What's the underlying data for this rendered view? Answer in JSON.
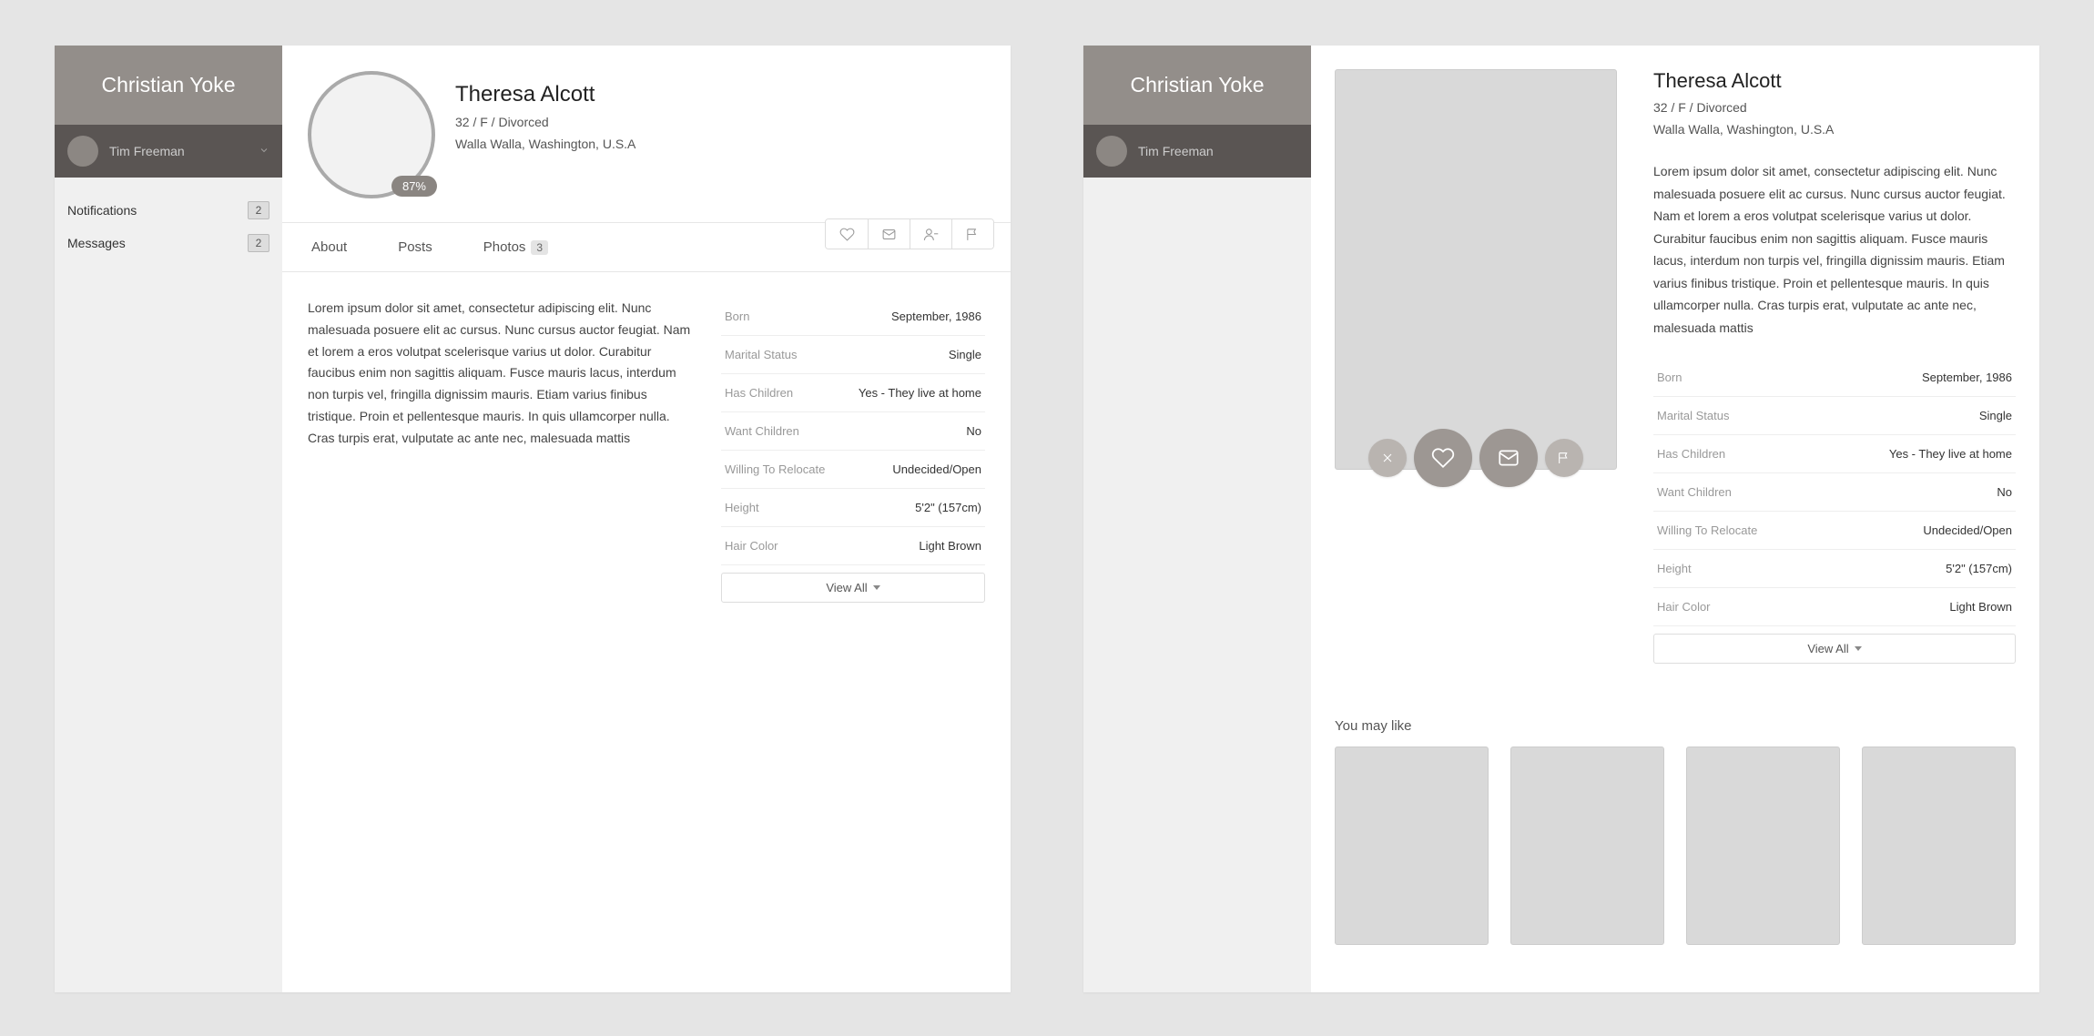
{
  "sidebar": {
    "brand": "Christian Yoke",
    "user_name": "Tim Freeman",
    "nav": [
      {
        "label": "Notifications",
        "count": "2"
      },
      {
        "label": "Messages",
        "count": "2"
      }
    ]
  },
  "profile": {
    "name": "Theresa Alcott",
    "meta": "32 / F / Divorced",
    "location": "Walla Walla, Washington, U.S.A",
    "match_percent": "87%",
    "bio": "Lorem ipsum dolor sit amet, consectetur adipiscing elit. Nunc malesuada posuere elit ac cursus. Nunc cursus auctor feugiat. Nam et lorem a eros volutpat scelerisque varius ut dolor. Curabitur faucibus enim non sagittis aliquam. Fusce mauris lacus, interdum non turpis vel, fringilla dignissim mauris. Etiam varius finibus tristique. Proin et pellentesque mauris. In quis ullamcorper nulla. Cras turpis erat, vulputate ac ante nec, malesuada mattis"
  },
  "tabs": {
    "about": "About",
    "posts": "Posts",
    "photos": "Photos",
    "photos_count": "3"
  },
  "details": [
    {
      "k": "Born",
      "v": "September, 1986"
    },
    {
      "k": "Marital Status",
      "v": "Single"
    },
    {
      "k": "Has Children",
      "v": "Yes - They live at home"
    },
    {
      "k": "Want Children",
      "v": "No"
    },
    {
      "k": "Willing To Relocate",
      "v": "Undecided/Open"
    },
    {
      "k": "Height",
      "v": "5'2\" (157cm)"
    },
    {
      "k": "Hair Color",
      "v": "Light Brown"
    }
  ],
  "view_all": "View All",
  "suggest_title": "You may like"
}
